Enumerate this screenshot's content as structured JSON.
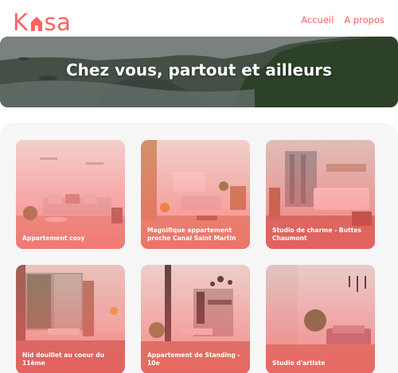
{
  "brand": {
    "logo_left": "K",
    "logo_right": "sa",
    "color": "#ff6060"
  },
  "nav": {
    "home_label": "Accueil",
    "about_label": "A propos"
  },
  "banner": {
    "title": "Chez vous, partout et ailleurs"
  },
  "listings": [
    {
      "title": "Appartement cosy"
    },
    {
      "title": "Magnifique appartement proche Canal Saint Martin"
    },
    {
      "title": "Studio de charme - Buttes Chaumont"
    },
    {
      "title": "Nid douillet au coeur du 11ème"
    },
    {
      "title": "Appartement de Standing - 10e"
    },
    {
      "title": "Studio d'artiste"
    }
  ]
}
